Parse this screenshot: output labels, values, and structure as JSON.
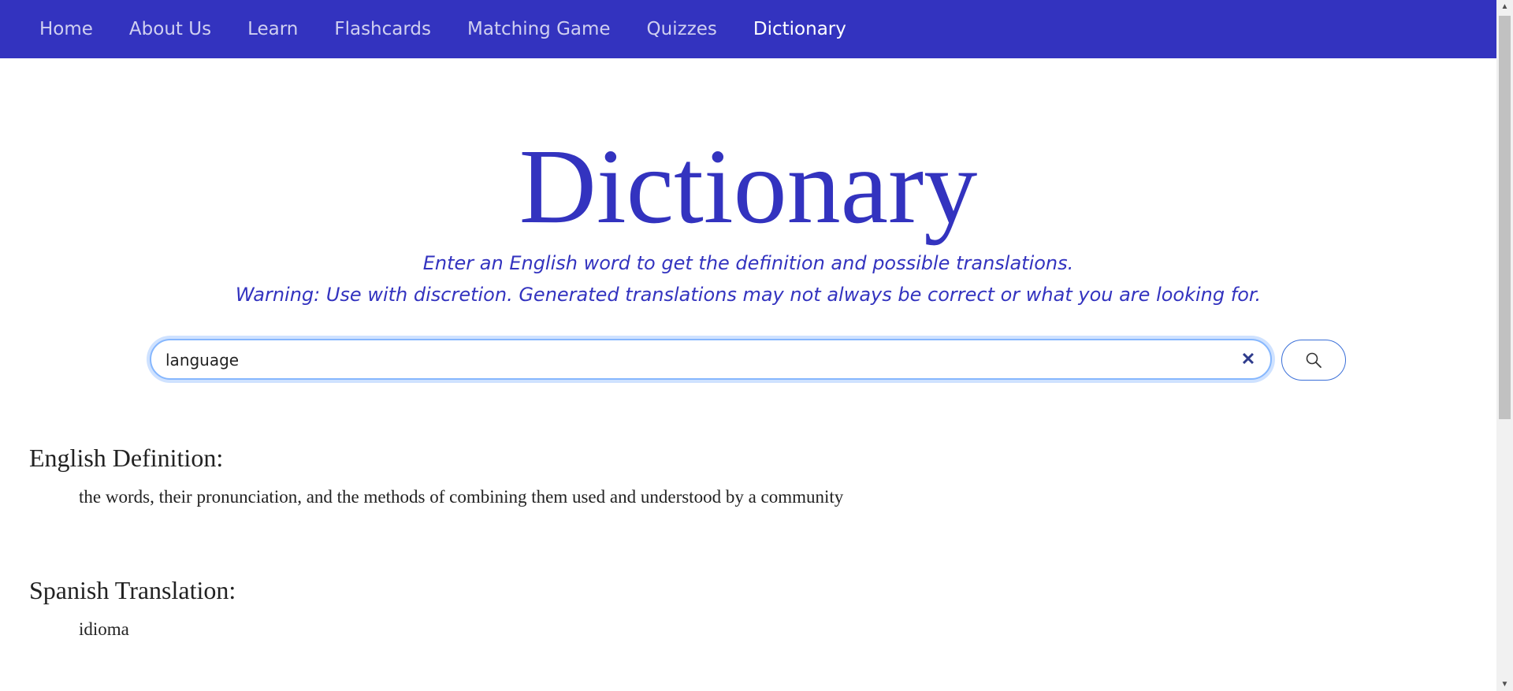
{
  "nav": {
    "items": [
      {
        "label": "Home"
      },
      {
        "label": "About Us"
      },
      {
        "label": "Learn"
      },
      {
        "label": "Flashcards"
      },
      {
        "label": "Matching Game"
      },
      {
        "label": "Quizzes"
      },
      {
        "label": "Dictionary"
      }
    ],
    "active": "Dictionary"
  },
  "page": {
    "title": "Dictionary",
    "subtitle1": "Enter an English word to get the definition and possible translations.",
    "subtitle2": "Warning: Use with discretion. Generated translations may not always be correct or what you are looking for."
  },
  "search": {
    "value": "language",
    "clear_icon": "x-icon",
    "button_icon": "search-icon"
  },
  "results": {
    "definition_heading": "English Definition:",
    "definition_text": "the words, their pronunciation, and the methods of combining them used and understood by a community",
    "translation_heading": "Spanish Translation:",
    "translation_text": "idioma"
  },
  "colors": {
    "brand": "#3333bf",
    "nav_text": "#d0d0f0",
    "nav_active": "#ffffff"
  }
}
